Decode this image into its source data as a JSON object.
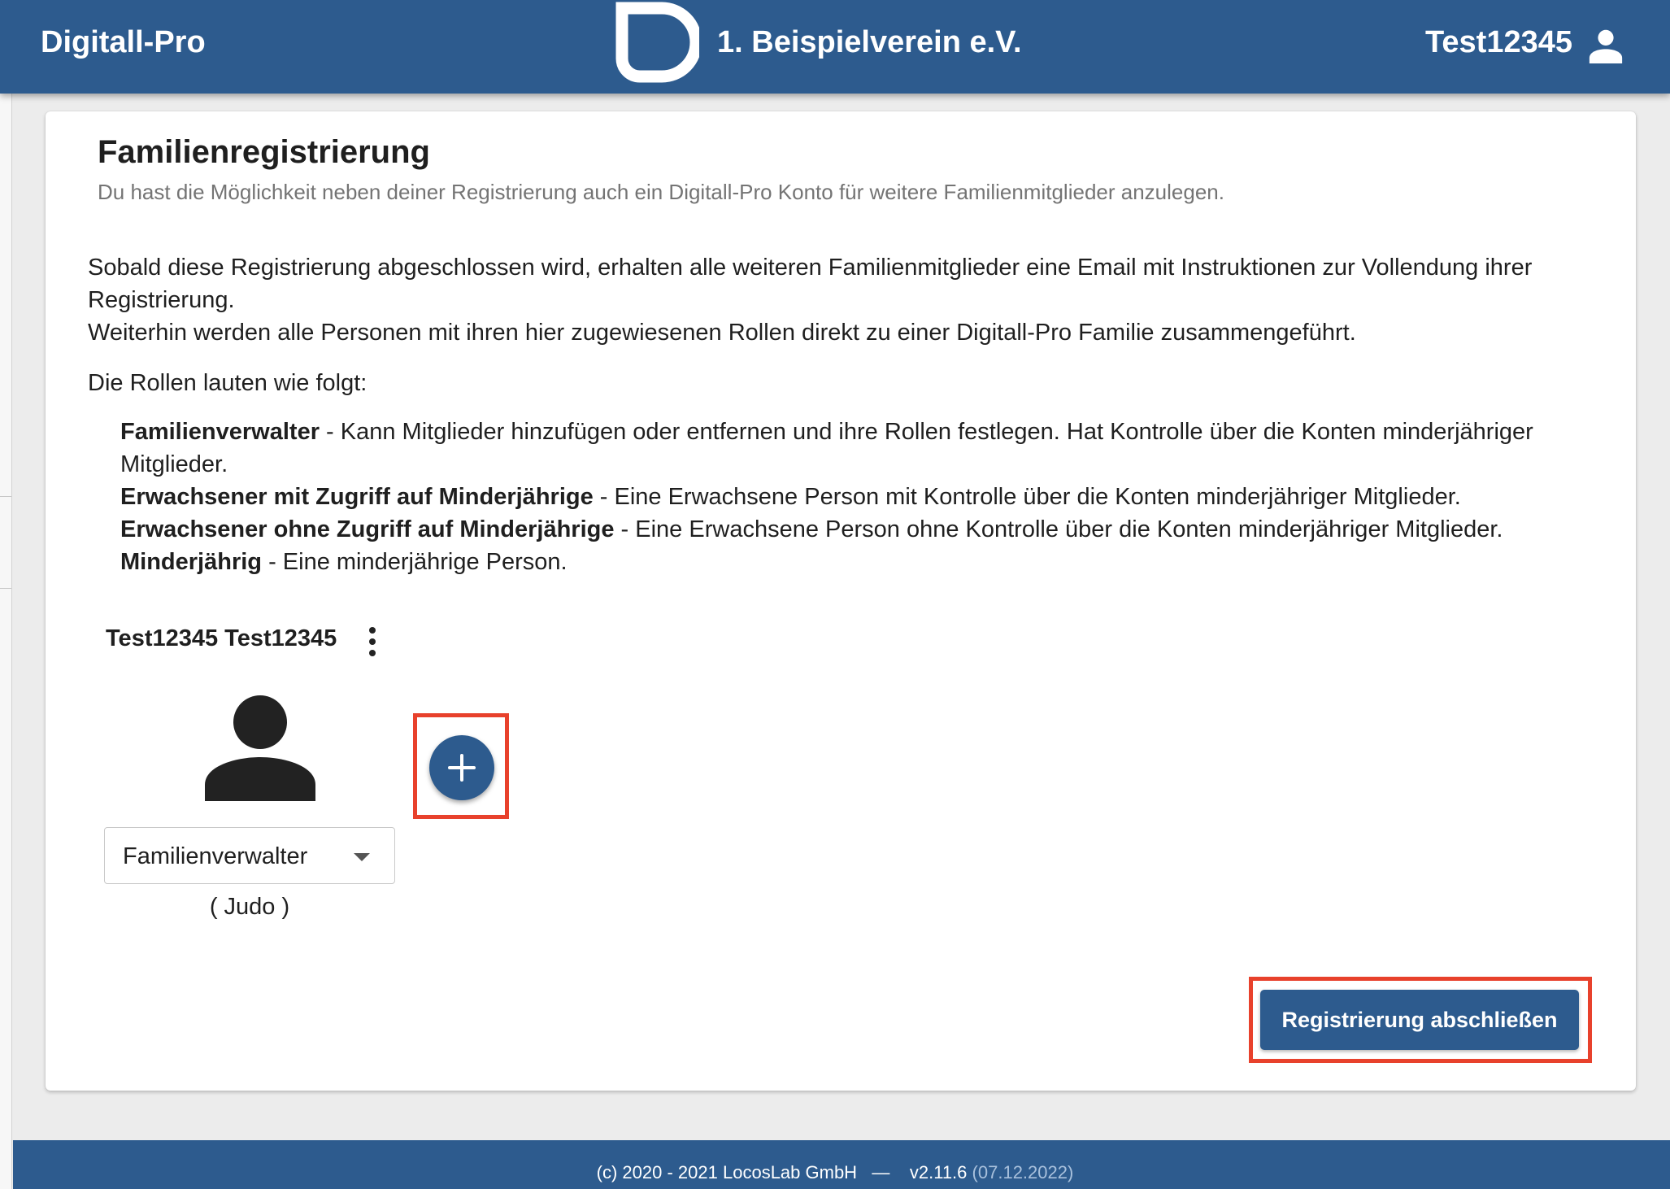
{
  "header": {
    "brand": "Digitall-Pro",
    "organization": "1. Beispielverein e.V.",
    "username": "Test12345",
    "user_icon": "account-icon",
    "logo_icon": "digitall-logo-icon"
  },
  "page": {
    "title": "Familienregistrierung",
    "subtitle": "Du hast die Möglichkeit neben deiner Registrierung auch ein Digitall-Pro Konto für weitere Familienmitglieder anzulegen.",
    "description_1": "Sobald diese Registrierung abgeschlossen wird, erhalten alle weiteren Familienmitglieder eine Email mit Instruktionen zur Vollendung ihrer Registrierung.",
    "description_2": "Weiterhin werden alle Personen mit ihren hier zugewiesenen Rollen direkt zu einer Digitall-Pro Familie zusammengeführt.",
    "roles_intro": "Die Rollen lauten wie folgt:",
    "roles": [
      {
        "name": "Familienverwalter",
        "description": " - Kann Mitglieder hinzufügen oder entfernen und ihre Rollen festlegen. Hat Kontrolle über die Konten minderjähriger Mitglieder."
      },
      {
        "name": "Erwachsener mit Zugriff auf Minderjährige",
        "description": " - Eine Erwachsene Person mit Kontrolle über die Konten minderjähriger Mitglieder."
      },
      {
        "name": "Erwachsener ohne Zugriff auf Minderjährige",
        "description": " - Eine Erwachsene Person ohne Kontrolle über die Konten minderjähriger Mitglieder."
      },
      {
        "name": "Minderjährig",
        "description": " - Eine minderjährige Person."
      }
    ]
  },
  "member": {
    "name": "Test12345 Test12345",
    "menu_icon": "more-vertical-icon",
    "avatar_icon": "person-icon",
    "role_selected": "Familienverwalter",
    "department": "( Judo )"
  },
  "actions": {
    "add_icon": "plus-icon",
    "submit_label": "Registrierung abschließen",
    "highlight_color": "#e8412c"
  },
  "footer": {
    "copyright": "(c) 2020 - 2021 LocosLab GmbH",
    "separator": "—",
    "version": "v2.11.6",
    "date": "(07.12.2022)"
  },
  "colors": {
    "primary": "#2d5b8e",
    "background": "#ececec",
    "card": "#ffffff"
  }
}
